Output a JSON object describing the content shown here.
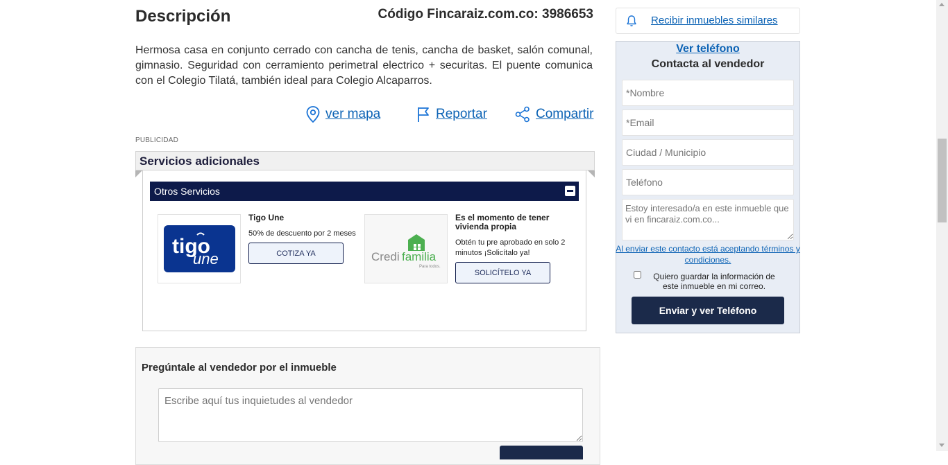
{
  "description": {
    "title": "Descripción",
    "code": "Código Fincaraiz.com.co: 3986653",
    "text": "Hermosa casa en conjunto cerrado con cancha de tenis, cancha de basket, salón comunal, gimnasio. Seguridad con cerramiento perimetral electrico + securitas. El puente comunica con el Colegio Tilatá, también ideal para Colegio Alcaparros."
  },
  "actions": {
    "map": "ver mapa",
    "report": "Reportar",
    "share": "Compartir"
  },
  "ad_label": "PUBLICIDAD",
  "services": {
    "title": "Servicios adicionales",
    "section_label": "Otros Servicios",
    "items": [
      {
        "title": "Tigo Une",
        "text": "50% de descuento por 2 meses",
        "button": "COTIZA YA",
        "logo_text": "tigo",
        "logo_sub": "une"
      },
      {
        "title": "Es el momento de tener vivienda propia",
        "text": "Obtén tu pre aprobado en solo 2 minutos ¡Solicítalo ya!",
        "button": "SOLICÍTELO YA",
        "logo_text_a": "Credi",
        "logo_text_b": "familia",
        "logo_sub": "Para todos."
      }
    ]
  },
  "ask": {
    "title": "Pregúntale al vendedor por el inmueble",
    "placeholder": "Escribe aquí tus inquietudes al vendedor"
  },
  "right_panel": {
    "alert_link": "Recibir inmuebles similares",
    "phone_link": "Ver teléfono",
    "contact_title": "Contacta al vendedor",
    "fields": {
      "name": "*Nombre",
      "email": "*Email",
      "city": "Ciudad / Municipio",
      "phone": "Teléfono",
      "message": "Estoy interesado/a en este inmueble que vi en fincaraiz.com.co..."
    },
    "terms": "Al enviar este contacto está aceptando términos y condiciones.",
    "save_label": "Quiero guardar la información de este inmueble en mi correo.",
    "submit": "Enviar y ver Teléfono"
  },
  "colors": {
    "link": "#0c63b5",
    "navy": "#0d1a4a",
    "button_dark": "#1b2a4a",
    "panel_bg": "#e8edf5",
    "tigo_blue": "#0a3490",
    "credi_green": "#4caf50"
  },
  "icons": {
    "map": "map-pin-icon",
    "report": "flag-icon",
    "share": "share-icon",
    "alert": "bell-icon",
    "collapse": "minus-icon"
  }
}
